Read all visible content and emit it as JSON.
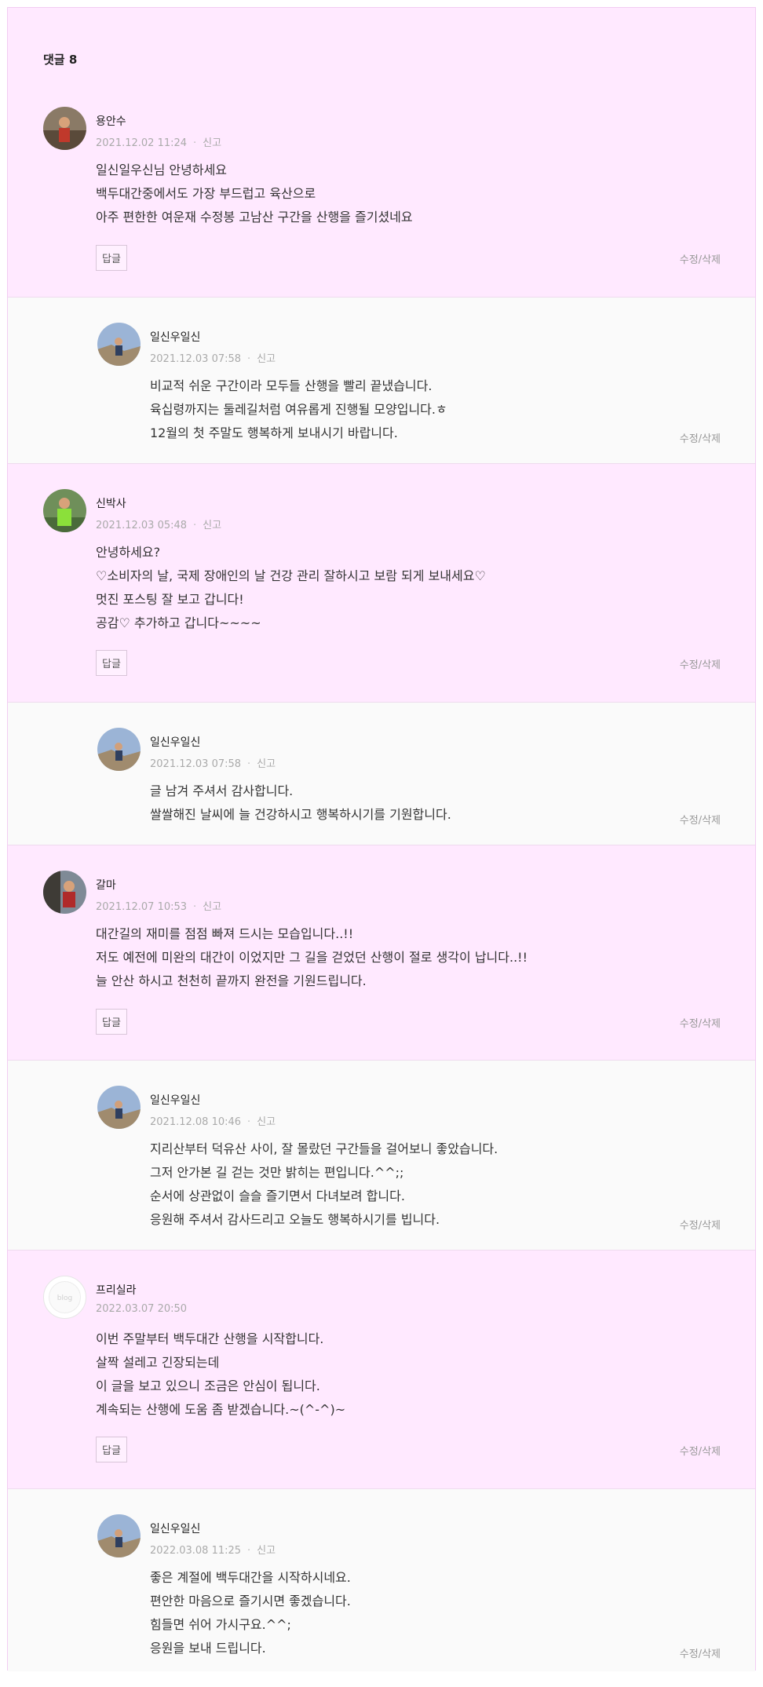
{
  "section": {
    "title": "댓글 8"
  },
  "labels": {
    "report": "신고",
    "reply": "답글",
    "edit_delete": "수정/삭제"
  },
  "comments": [
    {
      "author": "용안수",
      "date": "2021.12.02 11:24",
      "lines": [
        "일신일우신님 안녕하세요",
        "백두대간중에서도 가장 부드럽고 육산으로",
        "아주 편한한 여운재 수정봉 고남산 구간을 산행을 즐기셨네요"
      ]
    },
    {
      "author": "일신우일신",
      "date": "2021.12.03 07:58",
      "lines": [
        "비교적 쉬운 구간이라 모두들 산행을 빨리 끝냈습니다.",
        "육십령까지는 둘레길처럼 여유롭게 진행될 모양입니다.ㅎ",
        "12월의 첫 주말도 행복하게 보내시기 바랍니다."
      ]
    },
    {
      "author": "신박사",
      "date": "2021.12.03 05:48",
      "lines": [
        "안녕하세요?",
        "♡소비자의 날, 국제 장애인의 날 건강 관리 잘하시고 보람 되게 보내세요♡",
        "멋진 포스팅 잘 보고 갑니다!",
        "공감♡ 추가하고 갑니다~~~~"
      ]
    },
    {
      "author": "일신우일신",
      "date": "2021.12.03 07:58",
      "lines": [
        "글 남겨 주셔서 감사합니다.",
        "쌀쌀해진 날씨에 늘 건강하시고 행복하시기를 기원합니다."
      ]
    },
    {
      "author": "갈마",
      "date": "2021.12.07 10:53",
      "lines": [
        "대간길의 재미를 점점 빠져 드시는 모습입니다..!!",
        "저도 예전에 미완의 대간이 이었지만 그 길을 걷었던 산행이 절로 생각이 납니다..!!",
        "늘 안산 하시고 천천히 끝까지 완전을 기원드립니다."
      ]
    },
    {
      "author": "일신우일신",
      "date": "2021.12.08 10:46",
      "lines": [
        "지리산부터 덕유산 사이, 잘 몰랐던 구간들을 걸어보니 좋았습니다.",
        "그저 안가본 길 걷는 것만 밝히는 편입니다.^^;;",
        "순서에 상관없이 슬슬 즐기면서 다녀보려 합니다.",
        "응원해 주셔서 감사드리고 오늘도 행복하시기를 빕니다."
      ]
    },
    {
      "author": "프리실라",
      "date": "2022.03.07 20:50",
      "avatar_text": "blog",
      "lines": [
        "이번 주말부터 백두대간 산행을 시작합니다.",
        "살짝 설레고 긴장되는데",
        "이 글을 보고 있으니 조금은 안심이 됩니다.",
        "계속되는 산행에 도움 좀 받겠습니다.~(^-^)~"
      ]
    },
    {
      "author": "일신우일신",
      "date": "2022.03.08 11:25",
      "lines": [
        "좋은 계절에 백두대간을 시작하시네요.",
        "편안한 마음으로 즐기시면 좋겠습니다.",
        "힘들면 쉬어 가시구요.^^;",
        "응원을 보내 드립니다."
      ]
    }
  ],
  "colors": {
    "comment_bg": "#ffe9ff",
    "reply_bg": "#fafafa",
    "border": "#f2cdf2"
  }
}
